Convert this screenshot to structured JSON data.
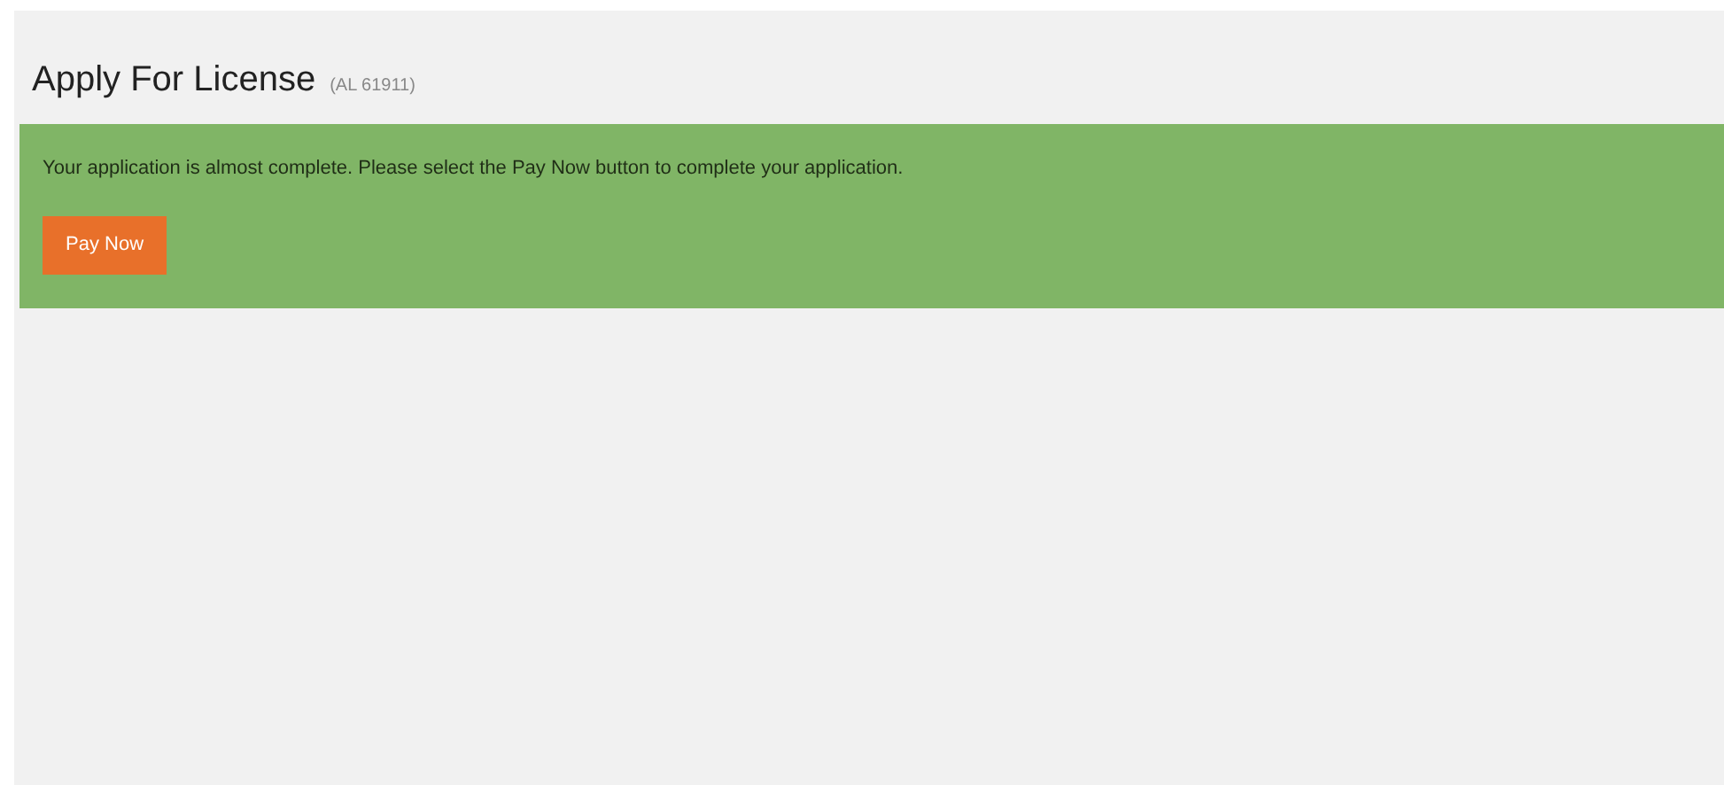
{
  "header": {
    "title": "Apply For License",
    "reference": "(AL 61911)"
  },
  "notice": {
    "message": "Your application is almost complete. Please select the Pay Now button to complete your application.",
    "button": "Pay Now"
  }
}
